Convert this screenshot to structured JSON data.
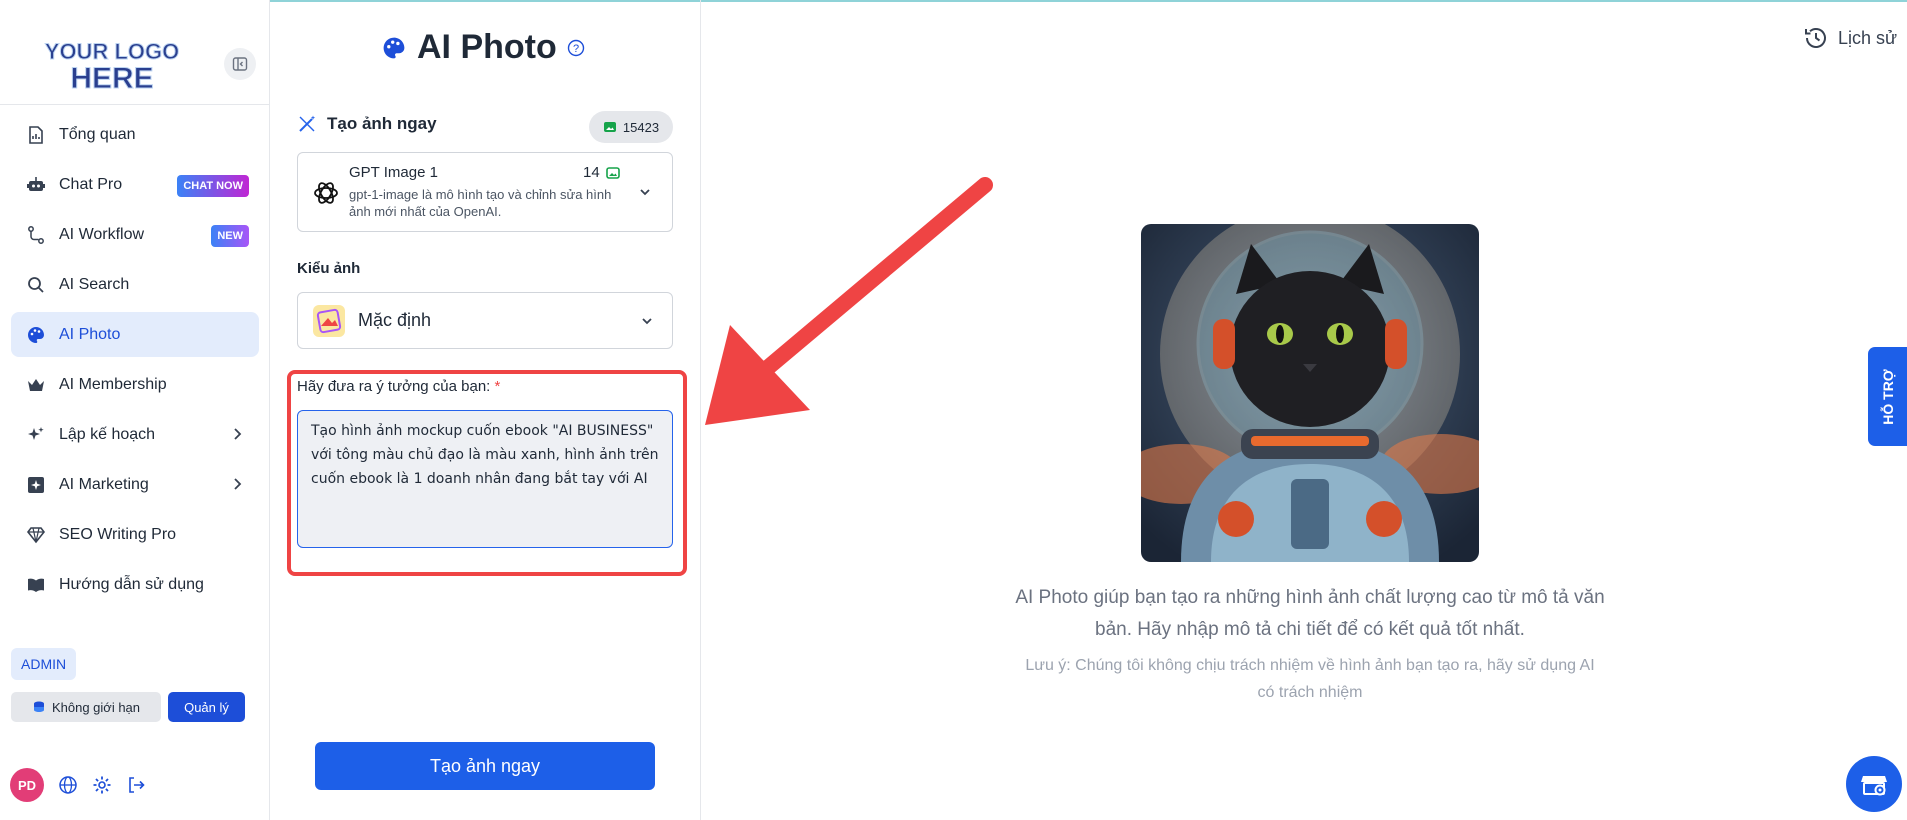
{
  "logo": {
    "line1": "YOUR LOGO",
    "line2": "HERE"
  },
  "sidebar": {
    "items": [
      {
        "label": "Tổng quan"
      },
      {
        "label": "Chat Pro",
        "badge": "CHAT NOW"
      },
      {
        "label": "AI Workflow",
        "badge": "NEW"
      },
      {
        "label": "AI Search"
      },
      {
        "label": "AI Photo",
        "active": true
      },
      {
        "label": "AI Membership"
      },
      {
        "label": "Lập kế hoạch"
      },
      {
        "label": "AI Marketing"
      },
      {
        "label": "SEO Writing Pro"
      },
      {
        "label": "Hướng dẫn sử dụng"
      }
    ],
    "role": "ADMIN",
    "quota": "Không giới hạn",
    "manage": "Quản lý",
    "avatar": "PD"
  },
  "form": {
    "title": "AI Photo",
    "section": "Tạo ảnh ngay",
    "credits": "15423",
    "model": {
      "name": "GPT Image 1",
      "cost": "14",
      "desc": "gpt-1-image là mô hình tạo và chỉnh sửa hình ảnh mới nhất của OpenAI."
    },
    "style_label": "Kiểu ảnh",
    "style_value": "Mặc định",
    "idea_label": "Hãy đưa ra ý tưởng của bạn:",
    "idea_required": "*",
    "idea_value": "Tạo hình ảnh mockup cuốn ebook \"AI BUSINESS\" với tông màu chủ đạo là màu xanh, hình ảnh trên cuốn ebook là 1 doanh nhân đang bắt tay với AI",
    "submit": "Tạo ảnh ngay"
  },
  "content": {
    "history": "Lịch sử",
    "desc": "AI Photo giúp bạn tạo ra những hình ảnh chất lượng cao từ mô tả văn bản. Hãy nhập mô tả chi tiết để có kết quả tốt nhất.",
    "note": "Lưu ý: Chúng tôi không chịu trách nhiệm về hình ảnh bạn tạo ra, hãy sử dụng AI có trách nhiệm",
    "support": "HỖ TRỢ"
  },
  "colors": {
    "accent": "#1d5fe8",
    "highlight": "#ef4444",
    "active_bg": "#e3ecfc"
  }
}
